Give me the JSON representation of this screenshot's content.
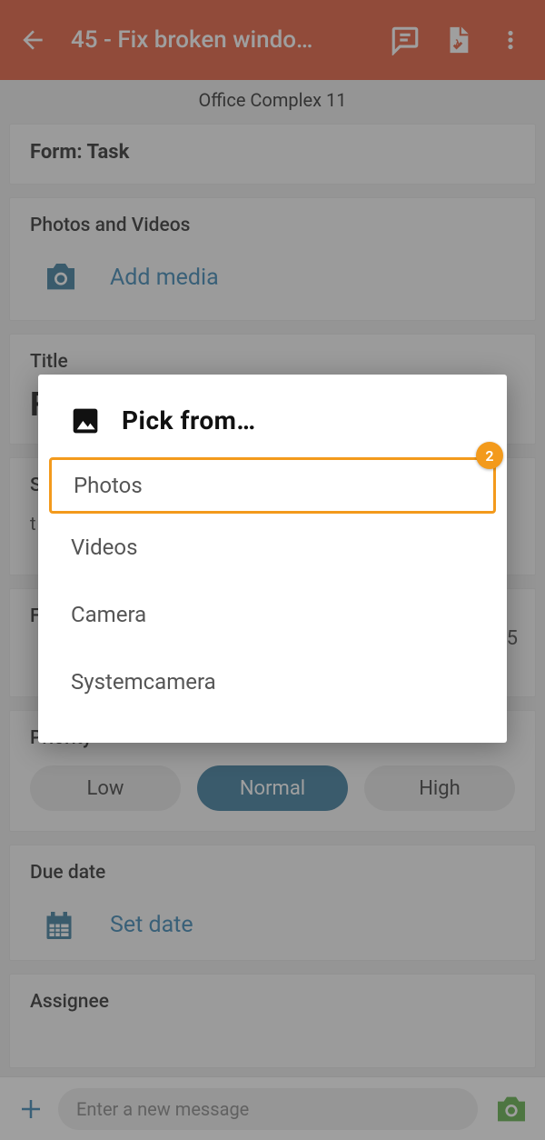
{
  "appbar": {
    "title": "45 - Fix broken windo…"
  },
  "subheader": "Office Complex 11",
  "form_card": {
    "label_prefix": "Form:",
    "label_value": "Task"
  },
  "media_card": {
    "label": "Photos and Videos",
    "action": "Add media"
  },
  "title_card": {
    "label": "Title",
    "value": "F"
  },
  "status_card": {
    "label": "S",
    "sub": "t"
  },
  "hidden_card": {
    "label": "F",
    "value": "5"
  },
  "priority_card": {
    "label": "Priority",
    "options": [
      "Low",
      "Normal",
      "High"
    ],
    "active": 1
  },
  "due_card": {
    "label": "Due date",
    "action": "Set date"
  },
  "assignee_card": {
    "label": "Assignee"
  },
  "msgbar": {
    "placeholder": "Enter a new message"
  },
  "dialog": {
    "title": "Pick from…",
    "items": [
      "Photos",
      "Videos",
      "Camera",
      "Systemcamera"
    ],
    "highlight_index": 0,
    "badge": "2"
  }
}
